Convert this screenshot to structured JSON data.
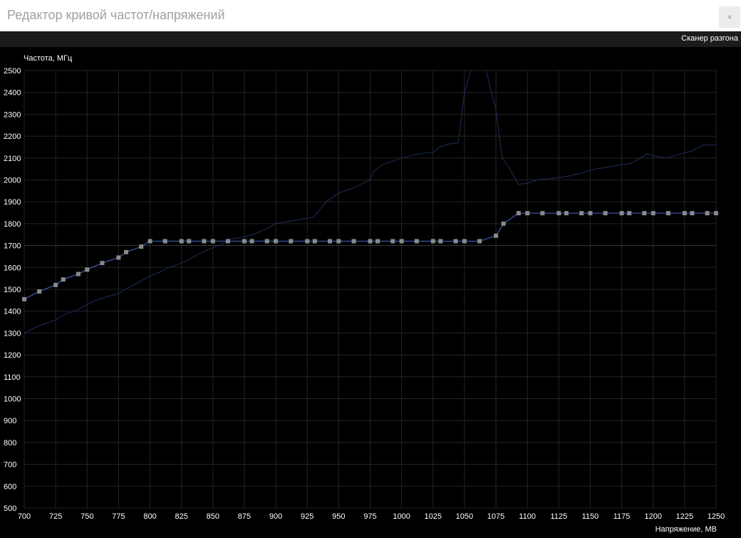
{
  "window": {
    "title": "Редактор кривой частот/напряжений",
    "close_icon": "close-icon",
    "close_glyph": "×"
  },
  "toolbar": {
    "scanner_label": "Сканер разгона"
  },
  "colors": {
    "curve": "#3a5cb0",
    "monitor": "#1e2f5c",
    "points": "#8a8a8a",
    "grid": "#242424",
    "reference": "#555555"
  },
  "chart_data": {
    "type": "line",
    "xlabel": "Напряжение, МВ",
    "ylabel": "Частота, МГц",
    "xlim": [
      700,
      1250
    ],
    "ylim": [
      500,
      2500
    ],
    "x_ticks": [
      700,
      725,
      750,
      775,
      800,
      825,
      850,
      875,
      900,
      925,
      950,
      975,
      1000,
      1025,
      1050,
      1075,
      1100,
      1125,
      1150,
      1175,
      1200,
      1225,
      1250
    ],
    "y_ticks": [
      500,
      600,
      700,
      800,
      900,
      1000,
      1100,
      1200,
      1300,
      1400,
      1500,
      1600,
      1700,
      1800,
      1900,
      2000,
      2100,
      2200,
      2300,
      2400,
      2500
    ],
    "grid": true,
    "reference_line": 1700,
    "series": [
      {
        "role": "curve",
        "x": [
          700,
          712,
          725,
          731,
          743,
          750,
          762,
          775,
          781,
          793,
          800,
          812,
          825,
          831,
          843,
          850,
          862,
          875,
          881,
          893,
          900,
          912,
          925,
          931,
          943,
          950,
          962,
          975,
          981,
          993,
          1000,
          1012,
          1025,
          1031,
          1043,
          1050,
          1062,
          1075,
          1081,
          1093,
          1100,
          1112,
          1125,
          1131,
          1143,
          1150,
          1162,
          1175,
          1181,
          1193,
          1200,
          1212,
          1225,
          1231,
          1243,
          1250
        ],
        "y": [
          1455,
          1490,
          1520,
          1545,
          1570,
          1590,
          1620,
          1645,
          1670,
          1695,
          1720,
          1720,
          1720,
          1720,
          1720,
          1720,
          1720,
          1720,
          1720,
          1720,
          1720,
          1720,
          1720,
          1720,
          1720,
          1720,
          1720,
          1720,
          1720,
          1720,
          1720,
          1720,
          1720,
          1720,
          1720,
          1720,
          1720,
          1745,
          1800,
          1848,
          1848,
          1848,
          1848,
          1848,
          1848,
          1848,
          1848,
          1848,
          1848,
          1848,
          1848,
          1848,
          1848,
          1848,
          1848,
          1848
        ]
      },
      {
        "role": "monitor",
        "x": [
          700,
          707,
          715,
          725,
          732,
          742,
          750,
          757,
          765,
          775,
          782,
          790,
          800,
          808,
          815,
          825,
          832,
          840,
          850,
          858,
          865,
          875,
          882,
          890,
          900,
          910,
          920,
          930,
          940,
          945,
          950,
          960,
          975,
          978,
          985,
          990,
          1000,
          1010,
          1020,
          1025,
          1030,
          1038,
          1045,
          1050,
          1055,
          1060,
          1065,
          1075,
          1080,
          1085,
          1093,
          1100,
          1108,
          1115,
          1125,
          1135,
          1145,
          1150,
          1160,
          1165,
          1175,
          1182,
          1190,
          1195,
          1200,
          1210,
          1220,
          1225,
          1230,
          1240,
          1250
        ],
        "y": [
          1300,
          1320,
          1340,
          1360,
          1385,
          1405,
          1430,
          1450,
          1465,
          1480,
          1505,
          1530,
          1560,
          1580,
          1600,
          1620,
          1640,
          1665,
          1690,
          1710,
          1730,
          1740,
          1750,
          1770,
          1800,
          1810,
          1820,
          1830,
          1900,
          1920,
          1940,
          1960,
          2000,
          2040,
          2070,
          2080,
          2100,
          2115,
          2125,
          2125,
          2150,
          2165,
          2170,
          2400,
          2500,
          2600,
          2550,
          2320,
          2100,
          2060,
          1980,
          1985,
          2000,
          2005,
          2010,
          2020,
          2035,
          2045,
          2055,
          2060,
          2070,
          2075,
          2100,
          2120,
          2110,
          2100,
          2115,
          2125,
          2130,
          2160,
          2160
        ]
      }
    ]
  }
}
